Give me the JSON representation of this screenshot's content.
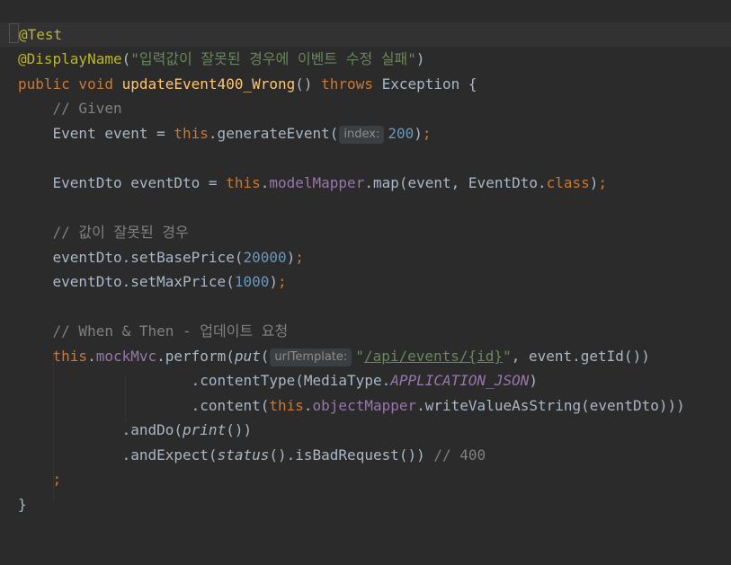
{
  "editor": {
    "lines": {
      "l1": {
        "a": "@Test"
      },
      "l2": {
        "a": "@DisplayName",
        "b": "(",
        "c": "\"입력값이 잘못된 경우에 이벤트 수정 실패\"",
        "d": ")"
      },
      "l3": {
        "a": "public void ",
        "b": "updateEvent400_Wrong",
        "c": "() ",
        "d": "throws ",
        "e": "Exception {"
      },
      "l4": {
        "a": "    // Given"
      },
      "l5": {
        "a": "    Event event = ",
        "b": "this",
        "c": ".generateEvent(",
        "hint": "index:",
        "d": "200",
        "e": ")",
        "f": ";"
      },
      "l7": {
        "a": "    EventDto eventDto = ",
        "b": "this",
        "c": ".",
        "d": "modelMapper",
        "e": ".map(event, EventDto.",
        "f": "class",
        "g": ")",
        "h": ";"
      },
      "l9": {
        "a": "    // 값이 잘못된 경우"
      },
      "l10": {
        "a": "    eventDto.setBasePrice(",
        "b": "20000",
        "c": ")",
        "d": ";"
      },
      "l11": {
        "a": "    eventDto.setMaxPrice(",
        "b": "1000",
        "c": ")",
        "d": ";"
      },
      "l13": {
        "a": "    // When & Then - 업데이트 요청"
      },
      "l14": {
        "a": "    ",
        "b": "this",
        "c": ".",
        "d": "mockMvc",
        "e": ".perform(",
        "f": "put",
        "g": "(",
        "hint": "urlTemplate:",
        "h": "\"",
        "i": "/api/events/{id}",
        "j": "\"",
        "k": ", event.getId())"
      },
      "l15": {
        "a": "                    .contentType(MediaType.",
        "b": "APPLICATION_JSON",
        "c": ")"
      },
      "l16": {
        "a": "                    .content(",
        "b": "this",
        "c": ".",
        "d": "objectMapper",
        "e": ".writeValueAsString(eventDto)))"
      },
      "l17": {
        "a": "            .andDo(",
        "b": "print",
        "c": "())"
      },
      "l18": {
        "a": "            .andExpect(",
        "b": "status",
        "c": "().isBadRequest()) ",
        "d": "// 400"
      },
      "l19": {
        "a": "    ",
        "b": ";"
      },
      "l20": {
        "a": "}"
      }
    }
  }
}
